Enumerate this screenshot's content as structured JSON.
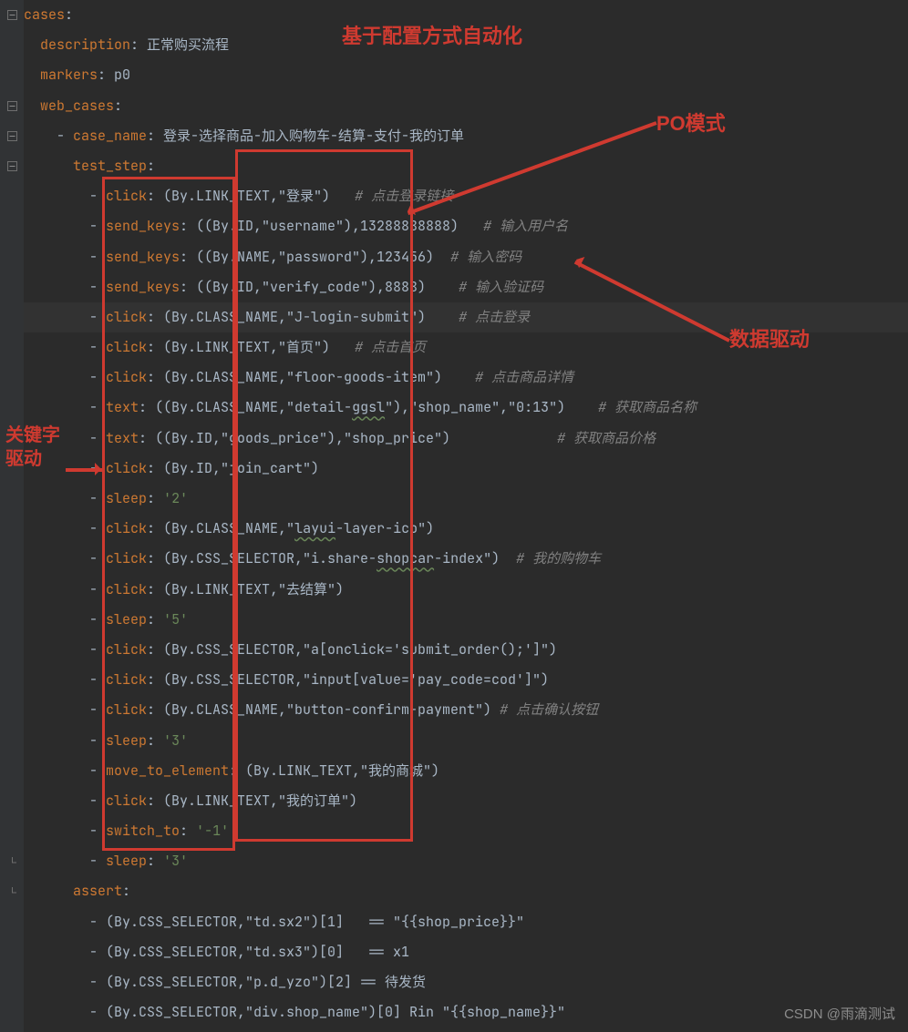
{
  "annotations": {
    "top_center": "基于配置方式自动化",
    "top_right": "PO模式",
    "left": "关键字\n驱动",
    "right": "数据驱动"
  },
  "watermark": "CSDN @雨滴测试",
  "chart_data": null,
  "lines": [
    {
      "indent": 0,
      "segs": [
        {
          "t": "cases",
          "c": "key"
        },
        {
          "t": ":",
          "c": "text"
        }
      ]
    },
    {
      "indent": 2,
      "segs": [
        {
          "t": "description",
          "c": "key"
        },
        {
          "t": ": 正常购买流程",
          "c": "text"
        }
      ]
    },
    {
      "indent": 2,
      "segs": [
        {
          "t": "markers",
          "c": "key"
        },
        {
          "t": ": p0",
          "c": "text"
        }
      ]
    },
    {
      "indent": 2,
      "segs": [
        {
          "t": "web_cases",
          "c": "key"
        },
        {
          "t": ":",
          "c": "text"
        }
      ]
    },
    {
      "indent": 4,
      "segs": [
        {
          "t": "- ",
          "c": "text"
        },
        {
          "t": "case_name",
          "c": "key"
        },
        {
          "t": ": 登录-选择商品-加入购物车-结算-支付-我的订单",
          "c": "text"
        }
      ]
    },
    {
      "indent": 6,
      "segs": [
        {
          "t": "test_step",
          "c": "key"
        },
        {
          "t": ":",
          "c": "text"
        }
      ]
    },
    {
      "indent": 8,
      "segs": [
        {
          "t": "- ",
          "c": "text"
        },
        {
          "t": "click",
          "c": "key"
        },
        {
          "t": ": (By.LINK_TEXT,\"登录\")   ",
          "c": "text"
        },
        {
          "t": "# 点击登录链接",
          "c": "cmt"
        }
      ]
    },
    {
      "indent": 8,
      "segs": [
        {
          "t": "- ",
          "c": "text"
        },
        {
          "t": "send_keys",
          "c": "key"
        },
        {
          "t": ": ((By.ID,\"username\"),13288888888)   ",
          "c": "text"
        },
        {
          "t": "# 输入用户名",
          "c": "cmt"
        }
      ]
    },
    {
      "indent": 8,
      "segs": [
        {
          "t": "- ",
          "c": "text"
        },
        {
          "t": "send_keys",
          "c": "key"
        },
        {
          "t": ": ((By.NAME,\"password\"),123456)  ",
          "c": "text"
        },
        {
          "t": "# 输入密码",
          "c": "cmt"
        }
      ]
    },
    {
      "indent": 8,
      "segs": [
        {
          "t": "- ",
          "c": "text"
        },
        {
          "t": "send_keys",
          "c": "key"
        },
        {
          "t": ": ((By.ID,\"verify_code\"),8888)    ",
          "c": "text"
        },
        {
          "t": "# 输入验证码",
          "c": "cmt"
        }
      ]
    },
    {
      "indent": 8,
      "hl": true,
      "segs": [
        {
          "t": "- ",
          "c": "text"
        },
        {
          "t": "click",
          "c": "key"
        },
        {
          "t": ": (By.CLASS_NAME,\"J-login-submit\")    ",
          "c": "text"
        },
        {
          "t": "# 点击登录",
          "c": "cmt"
        }
      ]
    },
    {
      "indent": 8,
      "segs": [
        {
          "t": "- ",
          "c": "text"
        },
        {
          "t": "click",
          "c": "key"
        },
        {
          "t": ": (By.LINK_TEXT,\"首页\")   ",
          "c": "text"
        },
        {
          "t": "# 点击首页",
          "c": "cmt"
        }
      ]
    },
    {
      "indent": 8,
      "segs": [
        {
          "t": "- ",
          "c": "text"
        },
        {
          "t": "click",
          "c": "key"
        },
        {
          "t": ": (By.CLASS_NAME,\"floor-goods-item\")    ",
          "c": "text"
        },
        {
          "t": "# 点击商品详情",
          "c": "cmt"
        }
      ]
    },
    {
      "indent": 8,
      "segs": [
        {
          "t": "- ",
          "c": "text"
        },
        {
          "t": "text",
          "c": "key"
        },
        {
          "t": ": ((By.CLASS_NAME,\"detail-",
          "c": "text"
        },
        {
          "t": "ggsl",
          "c": "text",
          "wavy": true
        },
        {
          "t": "\"),\"shop_name\",\"0:13\")    ",
          "c": "text"
        },
        {
          "t": "# 获取商品名称",
          "c": "cmt"
        }
      ]
    },
    {
      "indent": 8,
      "segs": [
        {
          "t": "- ",
          "c": "text"
        },
        {
          "t": "text",
          "c": "key"
        },
        {
          "t": ": ((By.ID,\"goods_price\"),\"shop_price\")             ",
          "c": "text"
        },
        {
          "t": "# 获取商品价格",
          "c": "cmt"
        }
      ]
    },
    {
      "indent": 8,
      "segs": [
        {
          "t": "- ",
          "c": "text"
        },
        {
          "t": "click",
          "c": "key"
        },
        {
          "t": ": (By.ID,\"join_cart\")",
          "c": "text"
        }
      ]
    },
    {
      "indent": 8,
      "segs": [
        {
          "t": "- ",
          "c": "text"
        },
        {
          "t": "sleep",
          "c": "key"
        },
        {
          "t": ": ",
          "c": "text"
        },
        {
          "t": "'2'",
          "c": "str"
        }
      ]
    },
    {
      "indent": 8,
      "segs": [
        {
          "t": "- ",
          "c": "text"
        },
        {
          "t": "click",
          "c": "key"
        },
        {
          "t": ": (By.CLASS_NAME,\"",
          "c": "text"
        },
        {
          "t": "layui",
          "c": "text",
          "wavy": true
        },
        {
          "t": "-layer-ico\")",
          "c": "text"
        }
      ]
    },
    {
      "indent": 8,
      "segs": [
        {
          "t": "- ",
          "c": "text"
        },
        {
          "t": "click",
          "c": "key"
        },
        {
          "t": ": (By.CSS_SELECTOR,\"i.share-",
          "c": "text"
        },
        {
          "t": "shopcar",
          "c": "text",
          "wavy": true
        },
        {
          "t": "-index\")  ",
          "c": "text"
        },
        {
          "t": "# 我的购物车",
          "c": "cmt"
        }
      ]
    },
    {
      "indent": 8,
      "segs": [
        {
          "t": "- ",
          "c": "text"
        },
        {
          "t": "click",
          "c": "key"
        },
        {
          "t": ": (By.LINK_TEXT,\"去结算\")",
          "c": "text"
        }
      ]
    },
    {
      "indent": 8,
      "segs": [
        {
          "t": "- ",
          "c": "text"
        },
        {
          "t": "sleep",
          "c": "key"
        },
        {
          "t": ": ",
          "c": "text"
        },
        {
          "t": "'5'",
          "c": "str"
        }
      ]
    },
    {
      "indent": 8,
      "segs": [
        {
          "t": "- ",
          "c": "text"
        },
        {
          "t": "click",
          "c": "key"
        },
        {
          "t": ": (By.CSS_SELECTOR,\"a[onclick='submit_order();']\")",
          "c": "text"
        }
      ]
    },
    {
      "indent": 8,
      "segs": [
        {
          "t": "- ",
          "c": "text"
        },
        {
          "t": "click",
          "c": "key"
        },
        {
          "t": ": (By.CSS_SELECTOR,\"input[value='pay_code=cod']\")",
          "c": "text"
        }
      ]
    },
    {
      "indent": 8,
      "segs": [
        {
          "t": "- ",
          "c": "text"
        },
        {
          "t": "click",
          "c": "key"
        },
        {
          "t": ": (By.CLASS_NAME,\"button-confirm-payment\") ",
          "c": "text"
        },
        {
          "t": "# 点击确认按钮",
          "c": "cmt"
        }
      ]
    },
    {
      "indent": 8,
      "segs": [
        {
          "t": "- ",
          "c": "text"
        },
        {
          "t": "sleep",
          "c": "key"
        },
        {
          "t": ": ",
          "c": "text"
        },
        {
          "t": "'3'",
          "c": "str"
        }
      ]
    },
    {
      "indent": 8,
      "segs": [
        {
          "t": "- ",
          "c": "text"
        },
        {
          "t": "move_to_element",
          "c": "key"
        },
        {
          "t": ": (By.LINK_TEXT,\"我的商城\")",
          "c": "text"
        }
      ]
    },
    {
      "indent": 8,
      "segs": [
        {
          "t": "- ",
          "c": "text"
        },
        {
          "t": "click",
          "c": "key"
        },
        {
          "t": ": (By.LINK_TEXT,\"我的订单\")",
          "c": "text"
        }
      ]
    },
    {
      "indent": 8,
      "segs": [
        {
          "t": "- ",
          "c": "text"
        },
        {
          "t": "switch_to",
          "c": "key"
        },
        {
          "t": ": ",
          "c": "text"
        },
        {
          "t": "'-1'",
          "c": "str"
        }
      ]
    },
    {
      "indent": 8,
      "segs": [
        {
          "t": "- ",
          "c": "text"
        },
        {
          "t": "sleep",
          "c": "key"
        },
        {
          "t": ": ",
          "c": "text"
        },
        {
          "t": "'3'",
          "c": "str"
        }
      ]
    },
    {
      "indent": 6,
      "segs": [
        {
          "t": "assert",
          "c": "key"
        },
        {
          "t": ":",
          "c": "text"
        }
      ]
    },
    {
      "indent": 8,
      "segs": [
        {
          "t": "- (By.CSS_SELECTOR,\"td.sx2\")[1]   == \"{{shop_price}}\"",
          "c": "text"
        }
      ]
    },
    {
      "indent": 8,
      "segs": [
        {
          "t": "- (By.CSS_SELECTOR,\"td.sx3\")[0]   == x1",
          "c": "text"
        }
      ]
    },
    {
      "indent": 8,
      "segs": [
        {
          "t": "- (By.CSS_SELECTOR,\"p.d_yzo\")[2] == 待发货",
          "c": "text"
        }
      ]
    },
    {
      "indent": 8,
      "segs": [
        {
          "t": "- (By.CSS_SELECTOR,\"div.shop_name\")[0] Rin \"{{shop_name}}\"",
          "c": "text"
        }
      ]
    }
  ],
  "gutter": [
    0,
    null,
    null,
    3,
    4,
    5,
    null,
    null,
    null,
    null,
    null,
    null,
    null,
    null,
    null,
    null,
    null,
    null,
    null,
    null,
    null,
    null,
    null,
    null,
    null,
    null,
    null,
    null,
    null,
    29,
    null,
    null,
    null,
    null
  ]
}
